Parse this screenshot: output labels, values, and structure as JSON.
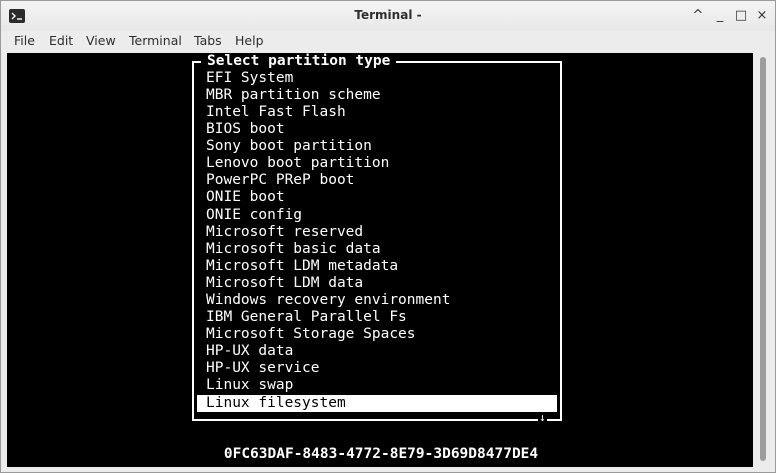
{
  "window": {
    "title": "Terminal -",
    "controls": {
      "up": "^",
      "minimize": "_",
      "maximize": "□",
      "close": "×"
    }
  },
  "menubar": {
    "items": [
      "File",
      "Edit",
      "View",
      "Terminal",
      "Tabs",
      "Help"
    ]
  },
  "dialog": {
    "title": "Select partition type",
    "options": [
      "EFI System",
      "MBR partition scheme",
      "Intel Fast Flash",
      "BIOS boot",
      "Sony boot partition",
      "Lenovo boot partition",
      "PowerPC PReP boot",
      "ONIE boot",
      "ONIE config",
      "Microsoft reserved",
      "Microsoft basic data",
      "Microsoft LDM metadata",
      "Microsoft LDM data",
      "Windows recovery environment",
      "IBM General Parallel Fs",
      "Microsoft Storage Spaces",
      "HP-UX data",
      "HP-UX service",
      "Linux swap",
      "Linux filesystem"
    ],
    "selected_option": "Linux filesystem",
    "more_indicator": "↓"
  },
  "status": {
    "guid": "0FC63DAF-8483-4772-8E79-3D69D8477DE4"
  },
  "colors": {
    "terminal_bg": "#000000",
    "terminal_fg": "#ffffff",
    "selection_bg": "#ffffff"
  }
}
